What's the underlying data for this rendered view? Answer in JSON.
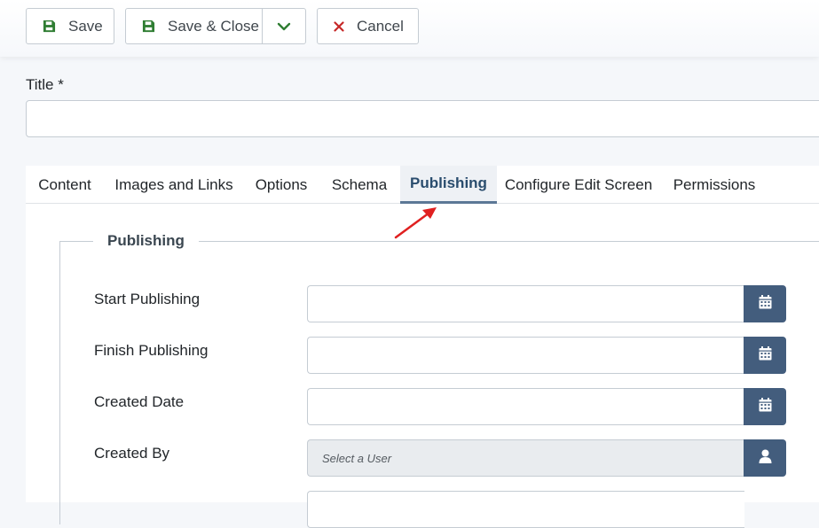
{
  "toolbar": {
    "save_label": "Save",
    "save_close_label": "Save & Close",
    "cancel_label": "Cancel"
  },
  "title_field": {
    "label": "Title *",
    "value": ""
  },
  "tabs": [
    {
      "label": "Content",
      "active": false
    },
    {
      "label": "Images and Links",
      "active": false
    },
    {
      "label": "Options",
      "active": false
    },
    {
      "label": "Schema",
      "active": false
    },
    {
      "label": "Publishing",
      "active": true
    },
    {
      "label": "Configure Edit Screen",
      "active": false
    },
    {
      "label": "Permissions",
      "active": false
    }
  ],
  "publishing": {
    "legend": "Publishing",
    "fields": [
      {
        "label": "Start Publishing",
        "value": "",
        "button_icon": "calendar-icon"
      },
      {
        "label": "Finish Publishing",
        "value": "",
        "button_icon": "calendar-icon"
      },
      {
        "label": "Created Date",
        "value": "",
        "button_icon": "calendar-icon"
      },
      {
        "label": "Created By",
        "value": "Select a User",
        "button_icon": "user-icon"
      }
    ]
  },
  "colors": {
    "accent": "#435d7d",
    "save_icon": "#2f7d32",
    "cancel_icon": "#c62828",
    "annotation_arrow": "#e02020"
  }
}
